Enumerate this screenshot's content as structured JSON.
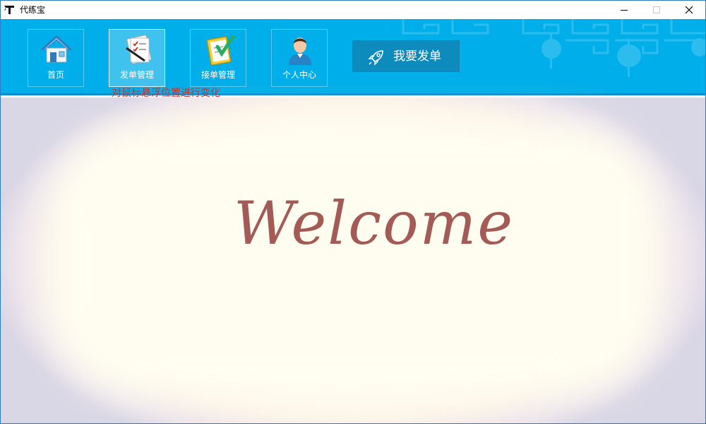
{
  "window": {
    "title": "代练宝",
    "controls": [
      "minimize",
      "maximize",
      "close"
    ]
  },
  "toolbar": {
    "nav": [
      {
        "label": "首页",
        "icon": "home-icon"
      },
      {
        "label": "发单管理",
        "icon": "order-checklist-icon"
      },
      {
        "label": "接单管理",
        "icon": "clipboard-check-icon"
      },
      {
        "label": "个人中心",
        "icon": "user-avatar-icon"
      }
    ],
    "hovered_item": "发单管理",
    "post_button": {
      "label": "我要发单",
      "icon": "rocket-icon"
    },
    "hover_note": "对鼠标悬浮位置进行变化",
    "colors": {
      "bar": "#00aee9",
      "post_button": "#0d8bbd",
      "note": "#d0302a"
    }
  },
  "main": {
    "welcome_text": "Welcome",
    "colors": {
      "welcome": "#a45a55",
      "background": "#fffdef"
    }
  }
}
